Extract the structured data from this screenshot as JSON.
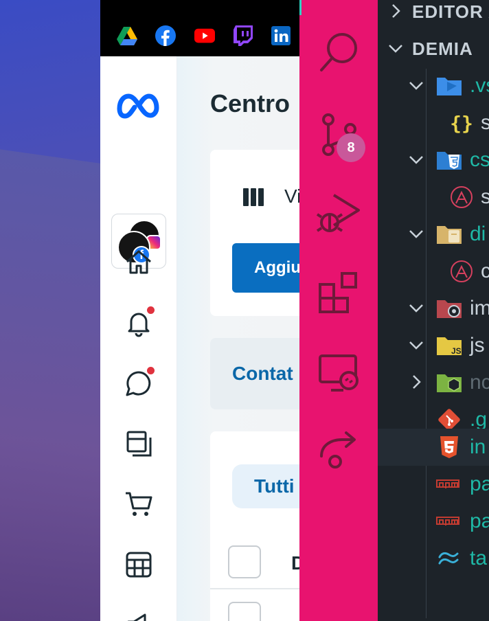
{
  "browser": {
    "bookmarks": [
      {
        "name": "google-drive"
      },
      {
        "name": "facebook"
      },
      {
        "name": "youtube"
      },
      {
        "name": "twitch"
      },
      {
        "name": "linkedin"
      }
    ],
    "meta": {
      "page_title": "Centro",
      "view_label": "Vi",
      "add_button": "Aggiu",
      "contacts_tab": "Contat",
      "all_filter": "Tutti",
      "column_header": "D",
      "colors": {
        "primary": "#0a6ec0",
        "link": "#0a67a8",
        "notification": "#e0323e"
      }
    }
  },
  "vscode": {
    "activity_badge": "8",
    "explorer": {
      "editors_header": "EDITOR A",
      "project_header": "DEMIA",
      "items": [
        {
          "label": ".vs",
          "icon": "vscode-folder-icon",
          "color": "#1fb8a6"
        },
        {
          "label": "s",
          "icon": "json-braces-icon",
          "color": "#c8d1d9"
        },
        {
          "label": "cs",
          "icon": "css-folder-icon",
          "color": "#1fb8a6"
        },
        {
          "label": "s",
          "icon": "sass-file-icon",
          "color": "#c8d1d9"
        },
        {
          "label": "di",
          "icon": "dist-folder-icon",
          "color": "#1fb8a6"
        },
        {
          "label": "c",
          "icon": "sass-file-icon",
          "color": "#c8d1d9"
        },
        {
          "label": "im",
          "icon": "images-folder-icon",
          "color": "#c8d1d9"
        },
        {
          "label": "js",
          "icon": "js-folder-icon",
          "color": "#c8d1d9"
        },
        {
          "label": "nc",
          "icon": "node-modules-folder-icon",
          "color": "#5f6b73"
        },
        {
          "label": ".g",
          "icon": "git-file-icon",
          "color": "#1fb8a6"
        },
        {
          "label": "in",
          "icon": "html5-file-icon",
          "color": "#1fb8a6"
        },
        {
          "label": "pa",
          "icon": "npm-file-icon",
          "color": "#1fb8a6"
        },
        {
          "label": "pa",
          "icon": "npm-file-icon",
          "color": "#1fb8a6"
        },
        {
          "label": "ta",
          "icon": "tailwind-file-icon",
          "color": "#1fb8a6"
        }
      ]
    }
  }
}
